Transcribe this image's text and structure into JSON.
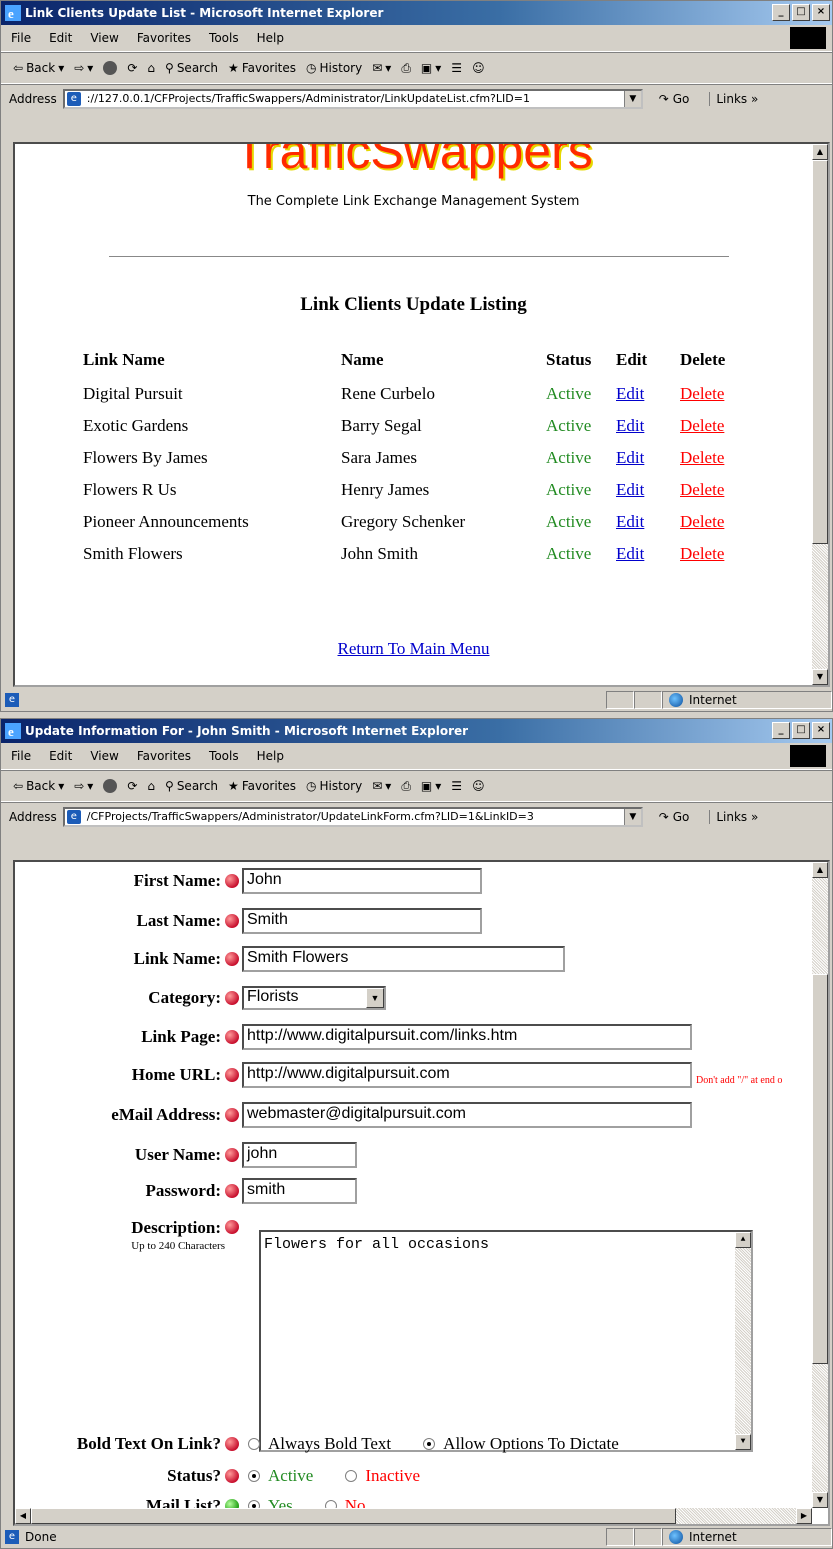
{
  "window1": {
    "title": "Link Clients Update List - Microsoft Internet Explorer",
    "menu": [
      "File",
      "Edit",
      "View",
      "Favorites",
      "Tools",
      "Help"
    ],
    "toolbar": {
      "back": "Back",
      "search": "Search",
      "favorites": "Favorites",
      "history": "History"
    },
    "address_label": "Address",
    "address_value": "://127.0.0.1/CFProjects/TrafficSwappers/Administrator/LinkUpdateList.cfm?LID=1",
    "go": "Go",
    "links": "Links",
    "logo": "TrafficSwappers",
    "tagline": "The Complete Link Exchange Management System",
    "listing_title": "Link Clients Update Listing",
    "columns": [
      "Link Name",
      "Name",
      "Status",
      "Edit",
      "Delete"
    ],
    "rows": [
      {
        "link_name": "Digital Pursuit",
        "name": "Rene Curbelo",
        "status": "Active",
        "edit": "Edit",
        "delete": "Delete"
      },
      {
        "link_name": "Exotic Gardens",
        "name": "Barry Segal",
        "status": "Active",
        "edit": "Edit",
        "delete": "Delete"
      },
      {
        "link_name": "Flowers By James",
        "name": "Sara James",
        "status": "Active",
        "edit": "Edit",
        "delete": "Delete"
      },
      {
        "link_name": "Flowers R Us",
        "name": "Henry James",
        "status": "Active",
        "edit": "Edit",
        "delete": "Delete"
      },
      {
        "link_name": "Pioneer Announcements",
        "name": "Gregory Schenker",
        "status": "Active",
        "edit": "Edit",
        "delete": "Delete"
      },
      {
        "link_name": "Smith Flowers",
        "name": "John Smith",
        "status": "Active",
        "edit": "Edit",
        "delete": "Delete"
      }
    ],
    "return_link": "Return To Main Menu",
    "status_zone": "Internet"
  },
  "window2": {
    "title": "Update Information For - John Smith - Microsoft Internet Explorer",
    "menu": [
      "File",
      "Edit",
      "View",
      "Favorites",
      "Tools",
      "Help"
    ],
    "toolbar": {
      "back": "Back",
      "search": "Search",
      "favorites": "Favorites",
      "history": "History"
    },
    "address_label": "Address",
    "address_value": "/CFProjects/TrafficSwappers/Administrator/UpdateLinkForm.cfm?LID=1&LinkID=3",
    "go": "Go",
    "links": "Links",
    "form": {
      "first_name": {
        "label": "First Name:",
        "value": "John"
      },
      "last_name": {
        "label": "Last Name:",
        "value": "Smith"
      },
      "link_name": {
        "label": "Link Name:",
        "value": "Smith Flowers"
      },
      "category": {
        "label": "Category:",
        "value": "Florists"
      },
      "link_page": {
        "label": "Link Page:",
        "value": "http://www.digitalpursuit.com/links.htm"
      },
      "home_url": {
        "label": "Home URL:",
        "value": "http://www.digitalpursuit.com",
        "hint": "Don't add \"/\" at end o"
      },
      "email": {
        "label": "eMail Address:",
        "value": "webmaster@digitalpursuit.com"
      },
      "user_name": {
        "label": "User Name:",
        "value": "john"
      },
      "password": {
        "label": "Password:",
        "value": "smith"
      },
      "description": {
        "label": "Description:",
        "sublabel": "Up to 240 Characters",
        "value": "Flowers for all occasions"
      },
      "bold_text": {
        "label": "Bold Text On Link?",
        "option1": "Always Bold Text",
        "option2": "Allow Options To Dictate",
        "selected": "option2"
      },
      "status": {
        "label": "Status?",
        "option1": "Active",
        "option2": "Inactive",
        "selected": "option1"
      },
      "mail_list": {
        "label": "Mail List?",
        "option1": "Yes",
        "option2": "No",
        "selected": "option1"
      }
    },
    "status_text": "Done",
    "status_zone": "Internet"
  },
  "colors": {
    "active_green": "#228b22",
    "link_blue": "#0000cc",
    "delete_red": "#ff0000",
    "required_dot": "#c8102e",
    "optional_dot": "#1f9e12"
  }
}
